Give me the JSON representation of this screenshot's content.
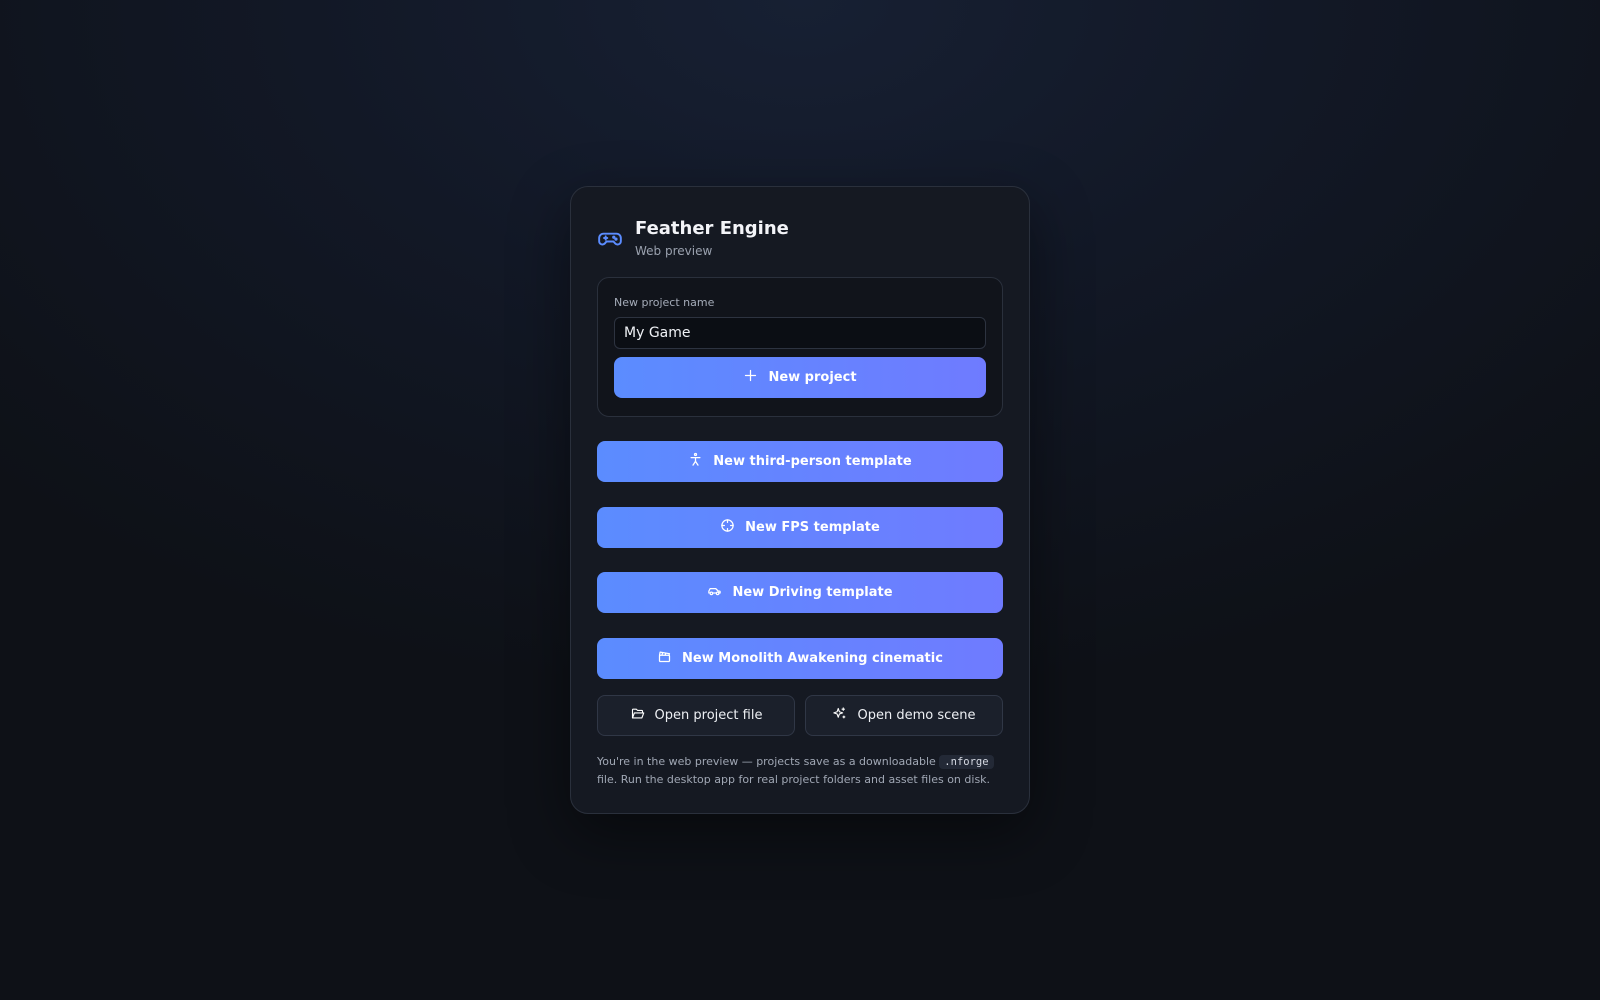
{
  "app": {
    "title": "Feather Engine",
    "subtitle": "Web preview",
    "logo_icon": "gamepad-icon",
    "accent_color": "#5b8cff"
  },
  "new_project": {
    "label": "New project name",
    "value": "My Game",
    "button_label": "New project",
    "button_icon": "plus-icon"
  },
  "templates": [
    {
      "label": "New third-person template",
      "icon": "person-icon"
    },
    {
      "label": "New FPS template",
      "icon": "crosshair-icon"
    },
    {
      "label": "New Driving template",
      "icon": "car-icon"
    },
    {
      "label": "New Monolith Awakening cinematic",
      "icon": "clapperboard-icon"
    }
  ],
  "actions": {
    "open_project_label": "Open project file",
    "open_project_icon": "folder-open-icon",
    "open_demo_label": "Open demo scene",
    "open_demo_icon": "sparkles-icon"
  },
  "footer": {
    "text_before": "You're in the web preview — projects save as a downloadable ",
    "code": ".nforge",
    "text_after": " file. Run the desktop app for real project folders and asset files on disk."
  }
}
